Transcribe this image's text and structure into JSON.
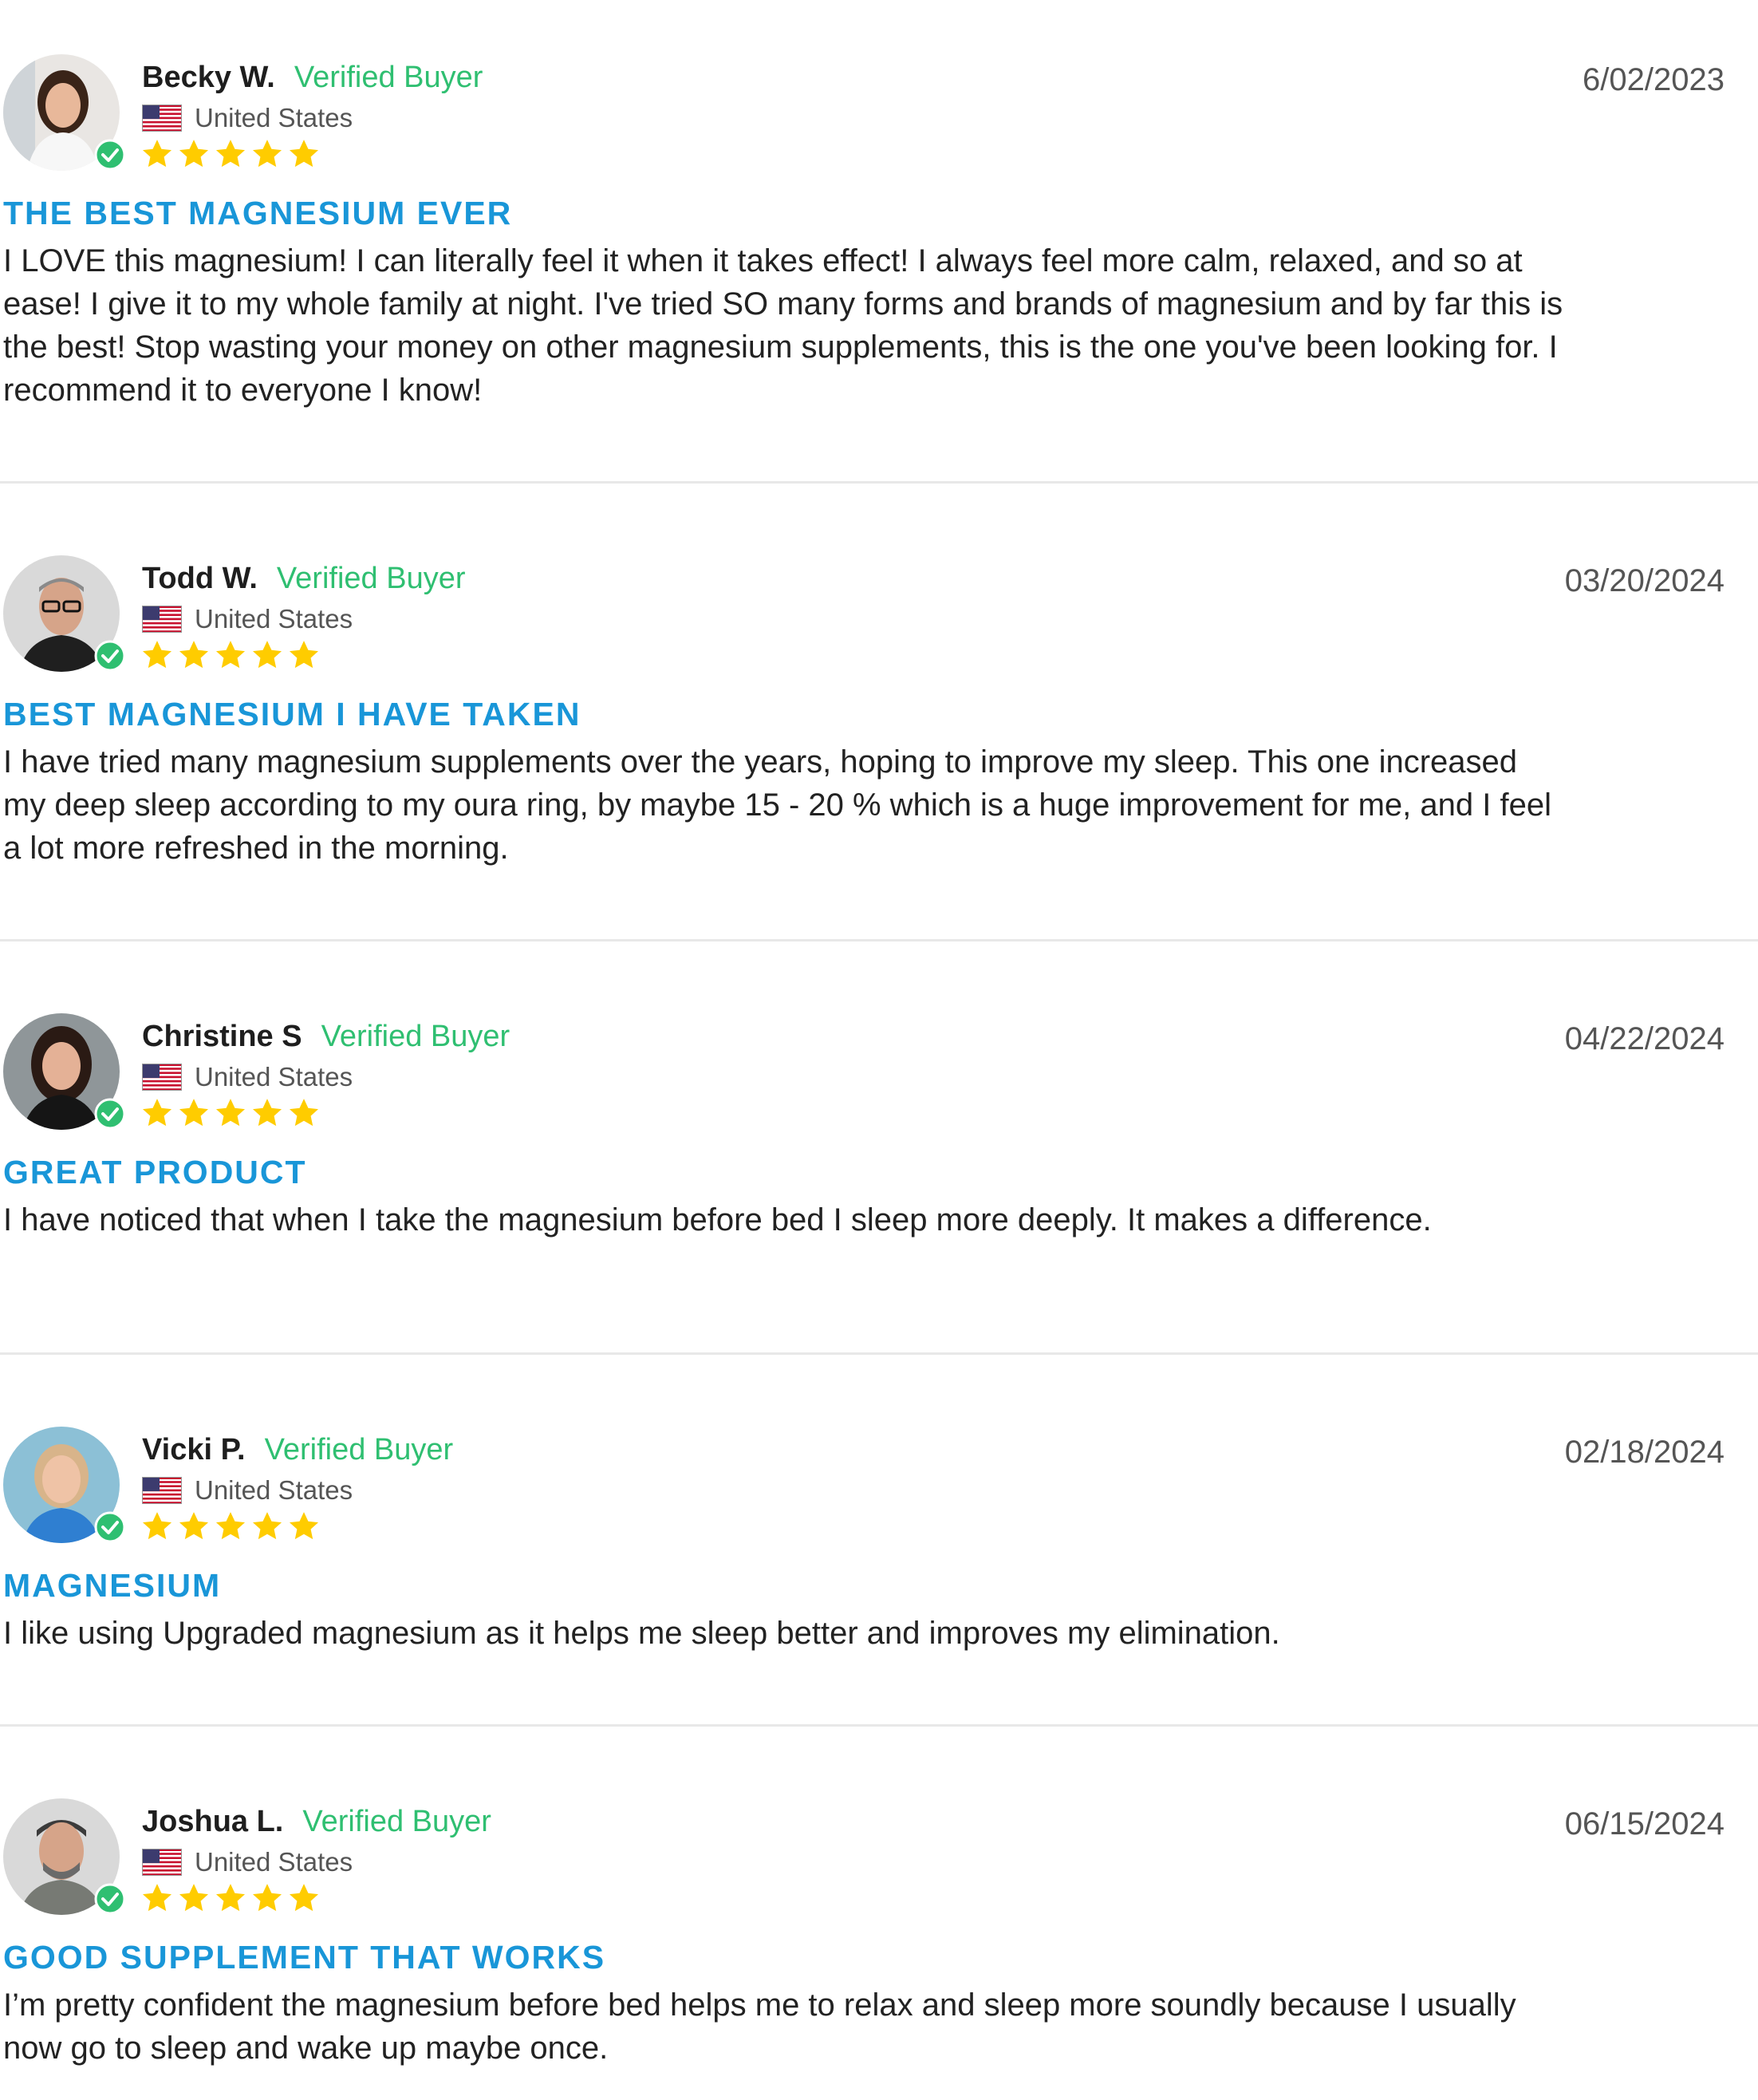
{
  "reviews": [
    {
      "name": "Becky W.",
      "verified": "Verified Buyer",
      "country": "United States",
      "date": "6/02/2023",
      "rating": 5,
      "title": "THE BEST MAGNESIUM EVER",
      "body": "I LOVE this magnesium! I can literally feel it when it takes effect! I always feel more calm, relaxed, and so at ease! I give it to my whole family at night. I've tried SO many forms and brands of magnesium and by far this is the best! Stop wasting your money on other magnesium supplements, this is the one you've been looking for. I recommend it to everyone I know!"
    },
    {
      "name": "Todd W.",
      "verified": "Verified Buyer",
      "country": "United States",
      "date": "03/20/2024",
      "rating": 5,
      "title": "BEST MAGNESIUM I HAVE TAKEN",
      "body": "I have tried many magnesium supplements over the years, hoping to improve my sleep. This one increased my deep sleep according to my oura ring, by maybe 15 - 20 % which is a huge improvement for me, and I feel a lot more refreshed in the morning."
    },
    {
      "name": "Christine S",
      "verified": "Verified Buyer",
      "country": "United States",
      "date": "04/22/2024",
      "rating": 5,
      "title": "GREAT PRODUCT",
      "body": "I have noticed that when I take the magnesium before bed I sleep more deeply. It makes a difference."
    },
    {
      "name": "Vicki P.",
      "verified": "Verified Buyer",
      "country": "United States",
      "date": "02/18/2024",
      "rating": 5,
      "title": "MAGNESIUM",
      "body": "I like using Upgraded magnesium as it helps me sleep better and improves my elimination."
    },
    {
      "name": "Joshua L.",
      "verified": "Verified Buyer",
      "country": "United States",
      "date": "06/15/2024",
      "rating": 5,
      "title": "GOOD SUPPLEMENT THAT WORKS",
      "body": "I’m pretty confident the magnesium before bed helps me to relax and sleep more soundly because I usually now go to sleep and wake up maybe once."
    }
  ],
  "colors": {
    "title_blue": "#1996d8",
    "verified_green": "#2fbf71",
    "star_gold": "#ffcc00",
    "divider": "#e8e8e8"
  },
  "icons": {
    "verified_badge": "check-circle-icon",
    "star": "star-icon",
    "flag": "us-flag-icon"
  }
}
